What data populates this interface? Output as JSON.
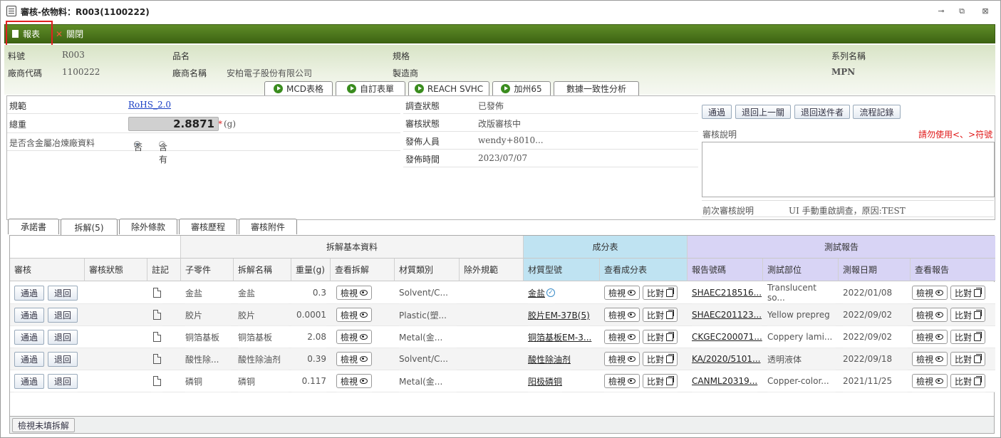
{
  "window": {
    "title": "審核-依物料：R003(1100222)"
  },
  "toolbar": {
    "report": "報表",
    "close": "關閉"
  },
  "info": {
    "part_no_label": "料號",
    "part_no": "R003",
    "name_label": "品名",
    "spec_label": "規格",
    "series_label": "系列名稱",
    "vendor_code_label": "廠商代碼",
    "vendor_code": "1100222",
    "vendor_name_label": "廠商名稱",
    "vendor_name": "安柏電子股份有限公司",
    "maker_label": "製造商",
    "mpn_label": "MPN"
  },
  "tabs_top": [
    "MCD表格",
    "自訂表單",
    "REACH SVHC",
    "加州65",
    "數據一致性分析"
  ],
  "form": {
    "reg_label": "規範",
    "reg_value": "RoHS_2.0",
    "weight_label": "總重",
    "weight_value": "2.8871",
    "weight_unit": "(g)",
    "smelter_label": "是否含金屬冶煉廠資料",
    "opt_no": "否",
    "opt_yes": "含有",
    "survey_label": "調查狀態",
    "survey_value": "已發佈",
    "review_state_label": "審核狀態",
    "review_state_value": "改版審核中",
    "publisher_label": "發佈人員",
    "publisher_value": "wendy+8010...",
    "pubtime_label": "發佈時間",
    "pubtime_value": "2023/07/07"
  },
  "actions": {
    "pass": "通過",
    "back_prev": "退回上一關",
    "back_sender": "退回送件者",
    "flow": "流程記錄",
    "note_label": "審核說明",
    "note_warn": "請勿使用<、>符號",
    "prev_note_label": "前次審核說明",
    "prev_note_value": "UI 手動重啟調查，原因:TEST"
  },
  "tabs_bottom": [
    "承諾書",
    "拆解(5)",
    "除外條款",
    "審核歷程",
    "審核附件"
  ],
  "grid": {
    "group_basic": "拆解基本資料",
    "group_comp": "成分表",
    "group_test": "測試報告",
    "headers": [
      "審核",
      "審核狀態",
      "註記",
      "子零件",
      "拆解名稱",
      "重量(g)",
      "查看拆解",
      "材質類別",
      "除外規範",
      "材質型號",
      "查看成分表",
      "報告號碼",
      "測試部位",
      "測報日期",
      "查看報告"
    ],
    "btn_pass": "通過",
    "btn_back": "退回",
    "btn_view": "檢視",
    "btn_compare": "比對",
    "rows": [
      {
        "part": "金盐",
        "name": "金盐",
        "weight": "0.3",
        "material": "Solvent/C...",
        "model": "金盐",
        "report": "SHAEC218516...",
        "position": "Translucent so...",
        "date": "2022/01/08"
      },
      {
        "part": "胶片",
        "name": "胶片",
        "weight": "0.0001",
        "material": "Plastic(塑...",
        "model": "胶片EM-37B(5)",
        "report": "SHAEC201123...",
        "position": "Yellow prepreg",
        "date": "2022/09/02"
      },
      {
        "part": "铜箔基板",
        "name": "铜箔基板",
        "weight": "2.08",
        "material": "Metal(金...",
        "model": "铜箔基板EM-3...",
        "report": "CKGEC200071...",
        "position": "Coppery lami...",
        "date": "2022/09/02"
      },
      {
        "part": "酸性除...",
        "name": "酸性除油剂",
        "weight": "0.39",
        "material": "Solvent/C...",
        "model": "酸性除油剂",
        "report": "KA/2020/5101...",
        "position": "透明液体",
        "date": "2022/09/18"
      },
      {
        "part": "磷铜",
        "name": "磷铜",
        "weight": "0.117",
        "material": "Metal(金...",
        "model": "阳极磷铜",
        "report": "CANML20319...",
        "position": "Copper-color...",
        "date": "2021/11/25"
      }
    ]
  },
  "bottom": {
    "unfilled": "檢視未填拆解"
  },
  "colors": {
    "toolbar": "#4a7419",
    "comp_header": "#bfe3f2",
    "test_header": "#d8d4f5"
  }
}
